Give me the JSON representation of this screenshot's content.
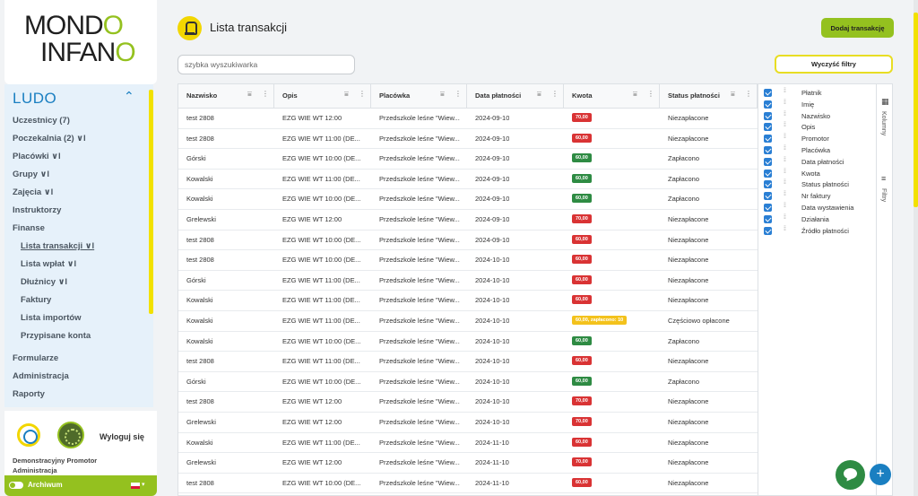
{
  "brand": {
    "line1": "MOND",
    "line1_o": "O",
    "line2": "INFAN",
    "line2_o": "O"
  },
  "sidebar": {
    "section": "LUDO",
    "items": [
      {
        "label": "Uczestnicy (7)"
      },
      {
        "label": "Poczekalnia (2) ∨l"
      },
      {
        "label": "Placówki ∨l"
      },
      {
        "label": "Grupy ∨l"
      },
      {
        "label": "Zajęcia ∨l"
      },
      {
        "label": "Instruktorzy"
      },
      {
        "label": "Finanse"
      },
      {
        "label": "Lista transakcji ∨l"
      },
      {
        "label": "Lista wpłat ∨l"
      },
      {
        "label": "Dłużnicy ∨l"
      },
      {
        "label": "Faktury"
      },
      {
        "label": "Lista importów"
      },
      {
        "label": "Przypisane konta"
      },
      {
        "label": "Formularze"
      },
      {
        "label": "Administracja"
      },
      {
        "label": "Raporty"
      }
    ],
    "user": {
      "logout": "Wyloguj się",
      "name": "Demonstracyjny Promotor",
      "role": "Administracja"
    },
    "archive": "Archiwum",
    "colors": {
      "accent": "#94c11f",
      "nav_bg": "#e6f1fa",
      "brand_blue": "#1a7fc1"
    }
  },
  "header": {
    "title": "Lista transakcji",
    "add_button": "Dodaj transakcję"
  },
  "search": {
    "placeholder": "szybka wyszukiwarka"
  },
  "clear_filters": "Wyczyść filtry",
  "table": {
    "columns": [
      "Nazwisko",
      "Opis",
      "Placówka",
      "Data płatności",
      "Kwota",
      "Status płatności"
    ],
    "rows": [
      {
        "name": "test 2808",
        "desc": "EZG WIE WT 12:00",
        "place": "Przedszkole leśne \"Wiew...",
        "date": "2024-09-10",
        "amount": "70,00",
        "status": "Niezapłacone",
        "color": "red"
      },
      {
        "name": "test 2808",
        "desc": "EZG WIE WT 11:00 (DE...",
        "place": "Przedszkole leśne \"Wiew...",
        "date": "2024-09-10",
        "amount": "60,00",
        "status": "Niezapłacone",
        "color": "red"
      },
      {
        "name": "Górski",
        "desc": "EZG WIE WT 10:00 (DE...",
        "place": "Przedszkole leśne \"Wiew...",
        "date": "2024-09-10",
        "amount": "60,00",
        "status": "Zapłacono",
        "color": "green"
      },
      {
        "name": "Kowalski",
        "desc": "EZG WIE WT 11:00 (DE...",
        "place": "Przedszkole leśne \"Wiew...",
        "date": "2024-09-10",
        "amount": "60,00",
        "status": "Zapłacono",
        "color": "green"
      },
      {
        "name": "Kowalski",
        "desc": "EZG WIE WT 10:00 (DE...",
        "place": "Przedszkole leśne \"Wiew...",
        "date": "2024-09-10",
        "amount": "60,00",
        "status": "Zapłacono",
        "color": "green"
      },
      {
        "name": "Grelewski",
        "desc": "EZG WIE WT 12:00",
        "place": "Przedszkole leśne \"Wiew...",
        "date": "2024-09-10",
        "amount": "70,00",
        "status": "Niezapłacone",
        "color": "red"
      },
      {
        "name": "test 2808",
        "desc": "EZG WIE WT 10:00 (DE...",
        "place": "Przedszkole leśne \"Wiew...",
        "date": "2024-09-10",
        "amount": "60,00",
        "status": "Niezapłacone",
        "color": "red"
      },
      {
        "name": "test 2808",
        "desc": "EZG WIE WT 10:00 (DE...",
        "place": "Przedszkole leśne \"Wiew...",
        "date": "2024-10-10",
        "amount": "60,00",
        "status": "Niezapłacone",
        "color": "red"
      },
      {
        "name": "Górski",
        "desc": "EZG WIE WT 11:00 (DE...",
        "place": "Przedszkole leśne \"Wiew...",
        "date": "2024-10-10",
        "amount": "60,00",
        "status": "Niezapłacone",
        "color": "red"
      },
      {
        "name": "Kowalski",
        "desc": "EZG WIE WT 11:00 (DE...",
        "place": "Przedszkole leśne \"Wiew...",
        "date": "2024-10-10",
        "amount": "60,00",
        "status": "Niezapłacone",
        "color": "red"
      },
      {
        "name": "Kowalski",
        "desc": "EZG WIE WT 11:00 (DE...",
        "place": "Przedszkole leśne \"Wiew...",
        "date": "2024-10-10",
        "amount": "60,00, zapłacono: 10",
        "status": "Częściowo opłacone",
        "color": "yellow"
      },
      {
        "name": "Kowalski",
        "desc": "EZG WIE WT 10:00 (DE...",
        "place": "Przedszkole leśne \"Wiew...",
        "date": "2024-10-10",
        "amount": "60,00",
        "status": "Zapłacono",
        "color": "green"
      },
      {
        "name": "test 2808",
        "desc": "EZG WIE WT 11:00 (DE...",
        "place": "Przedszkole leśne \"Wiew...",
        "date": "2024-10-10",
        "amount": "60,00",
        "status": "Niezapłacone",
        "color": "red"
      },
      {
        "name": "Górski",
        "desc": "EZG WIE WT 10:00 (DE...",
        "place": "Przedszkole leśne \"Wiew...",
        "date": "2024-10-10",
        "amount": "60,00",
        "status": "Zapłacono",
        "color": "green"
      },
      {
        "name": "test 2808",
        "desc": "EZG WIE WT 12:00",
        "place": "Przedszkole leśne \"Wiew...",
        "date": "2024-10-10",
        "amount": "70,00",
        "status": "Niezapłacone",
        "color": "red"
      },
      {
        "name": "Grelewski",
        "desc": "EZG WIE WT 12:00",
        "place": "Przedszkole leśne \"Wiew...",
        "date": "2024-10-10",
        "amount": "70,00",
        "status": "Niezapłacone",
        "color": "red"
      },
      {
        "name": "Kowalski",
        "desc": "EZG WIE WT 11:00 (DE...",
        "place": "Przedszkole leśne \"Wiew...",
        "date": "2024-11-10",
        "amount": "60,00",
        "status": "Niezapłacone",
        "color": "red"
      },
      {
        "name": "Grelewski",
        "desc": "EZG WIE WT 12:00",
        "place": "Przedszkole leśne \"Wiew...",
        "date": "2024-11-10",
        "amount": "70,00",
        "status": "Niezapłacone",
        "color": "red"
      },
      {
        "name": "test 2808",
        "desc": "EZG WIE WT 10:00 (DE...",
        "place": "Przedszkole leśne \"Wiew...",
        "date": "2024-11-10",
        "amount": "60,00",
        "status": "Niezapłacone",
        "color": "red"
      }
    ]
  },
  "columns_panel": {
    "items": [
      "Płatnik",
      "Imię",
      "Nazwisko",
      "Opis",
      "Promotor",
      "Placówka",
      "Data płatności",
      "Kwota",
      "Status płatności",
      "Nr faktury",
      "Data wystawienia",
      "Działania",
      "Źródło płatności"
    ],
    "tab_columns": "Kolumny",
    "tab_filters": "Filtry"
  },
  "icons": [
    "sort-filter-icon",
    "column-menu-icon",
    "columns-icon",
    "filter-icon",
    "chat-icon",
    "plus-icon",
    "chevron-up-icon",
    "drag-handle-icon",
    "checkbox-icon"
  ],
  "badge_colors": {
    "red": "#d93334",
    "green": "#2e8b43",
    "yellow": "#f3c21c"
  }
}
